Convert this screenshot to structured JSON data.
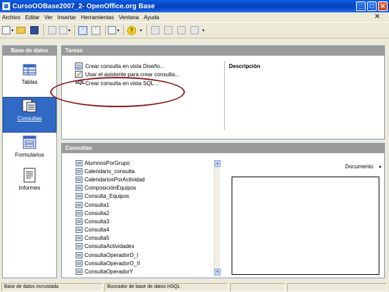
{
  "window": {
    "title": "CursoOOBase2007_2- OpenOffice.org Base",
    "controls": [
      "_",
      "□",
      "✕"
    ]
  },
  "menubar": {
    "items": [
      "Archivo",
      "Editar",
      "Ver",
      "Insertar",
      "Herramientas",
      "Ventana",
      "Ayuda"
    ],
    "close_doc": "✕"
  },
  "sidebar": {
    "header": "Base de datos",
    "items": [
      {
        "label": "Tablas",
        "icon": "table-icon"
      },
      {
        "label": "Consultas",
        "icon": "query-icon",
        "selected": true
      },
      {
        "label": "Formularios",
        "icon": "form-icon"
      },
      {
        "label": "Informes",
        "icon": "report-icon"
      }
    ]
  },
  "tasks": {
    "header": "Tareas",
    "items": [
      "Crear consulta en vista Diseño...",
      "Usar el asistente para crear consulta...",
      "Crear consulta en vista SQL..."
    ],
    "description_label": "Descripción"
  },
  "queries": {
    "header": "Consultas",
    "items": [
      "AlumnosPorGrupo",
      "Calendario_consulta",
      "CalendariosPorActividad",
      "ComposiciónEquipos",
      "Consulta_Equipos",
      "Consulta1",
      "Consulta2",
      "Consulta3",
      "Consulta4",
      "Consulta5",
      "ConsultaActividades",
      "ConsultaOperadorO_I",
      "ConsultaOperadorO_II",
      "ConsultaOperadorY"
    ],
    "preview_mode": "Documento"
  },
  "statusbar": {
    "db_type": "Base de datos incrustada",
    "engine": "Buscador de base de datos HSQL"
  },
  "colors": {
    "titlebar": "#0846c4",
    "selection": "#316ac5",
    "panel_header": "#9a9a9a",
    "annotation": "#8b1a1a"
  }
}
